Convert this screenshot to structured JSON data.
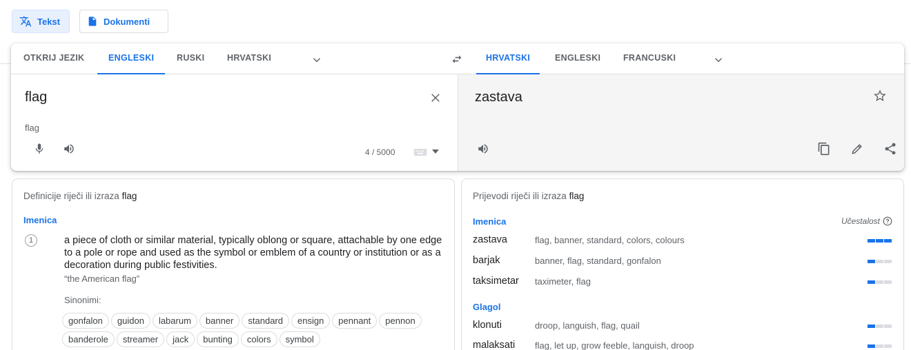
{
  "modes": {
    "text_label": "Tekst",
    "docs_label": "Dokumenti"
  },
  "source_langs": [
    "OTKRIJ JEZIK",
    "ENGLESKI",
    "RUSKI",
    "HRVATSKI"
  ],
  "target_langs": [
    "HRVATSKI",
    "ENGLESKI",
    "FRANCUSKI"
  ],
  "source": {
    "text": "flag",
    "transliteration": "flag",
    "counter": "4 / 5000"
  },
  "target": {
    "text": "zastava"
  },
  "definitions": {
    "title_prefix": "Definicije riječi ili izraza",
    "term": "flag",
    "pos": "Imenica",
    "number": "1",
    "definition": "a piece of cloth or similar material, typically oblong or square, attachable by one edge to a pole or rope and used as the symbol or emblem of a country or institution or as a decoration during public festivities.",
    "example": "“the American flag”",
    "synonyms_label": "Sinonimi:",
    "synonyms": [
      "gonfalon",
      "guidon",
      "labarum",
      "banner",
      "standard",
      "ensign",
      "pennant",
      "pennon",
      "banderole",
      "streamer",
      "jack",
      "bunting",
      "colors",
      "symbol"
    ]
  },
  "translations": {
    "title_prefix": "Prijevodi riječi ili izraza",
    "term": "flag",
    "frequency_label": "Učestalost",
    "groups": [
      {
        "pos": "Imenica",
        "rows": [
          {
            "word": "zastava",
            "back": "flag, banner, standard, colors, colours",
            "freq": 3
          },
          {
            "word": "barjak",
            "back": "banner, flag, standard, gonfalon",
            "freq": 1
          },
          {
            "word": "taksimetar",
            "back": "taximeter, flag",
            "freq": 1
          }
        ]
      },
      {
        "pos": "Glagol",
        "rows": [
          {
            "word": "klonuti",
            "back": "droop, languish, flag, quail",
            "freq": 1
          },
          {
            "word": "malaksati",
            "back": "flag, let up, grow feeble, languish, droop",
            "freq": 1
          }
        ]
      }
    ]
  },
  "colors": {
    "accent": "#1a73e8",
    "muted": "#5f6368",
    "target_bg": "#f5f5f5"
  }
}
